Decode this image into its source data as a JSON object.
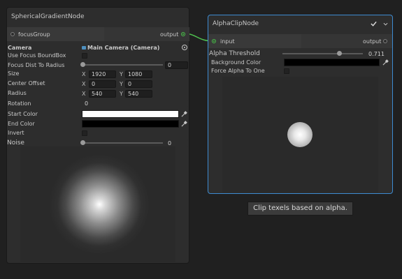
{
  "spherical_node": {
    "title": "SphericalGradientNode",
    "port": {
      "input_label": "focusGroup",
      "output_label": "output"
    },
    "camera": {
      "label": "Camera",
      "value": "Main Camera (Camera)"
    },
    "use_focus_boundbox": {
      "label": "Use Focus BoundBox",
      "checked": false
    },
    "focus_dist": {
      "label": "Focus Dist To Radius",
      "value": "0",
      "fraction": 0.0
    },
    "size": {
      "label": "Size",
      "x_axis": "X",
      "x": "1920",
      "y_axis": "Y",
      "y": "1080"
    },
    "center_offset": {
      "label": "Center Offset",
      "x_axis": "X",
      "x": "0",
      "y_axis": "Y",
      "y": "0"
    },
    "radius": {
      "label": "Radius",
      "x_axis": "X",
      "x": "540",
      "y_axis": "Y",
      "y": "540"
    },
    "rotation": {
      "label": "Rotation",
      "value": "0"
    },
    "start_color": {
      "label": "Start Color",
      "color": "#ffffff"
    },
    "end_color": {
      "label": "End Color",
      "color": "#000000"
    },
    "invert": {
      "label": "Invert",
      "checked": false
    },
    "noise": {
      "label": "Noise",
      "value": "0",
      "fraction": 0.0
    }
  },
  "alpha_node": {
    "title": "AlphaClipNode",
    "port": {
      "input_label": "input",
      "output_label": "output"
    },
    "alpha_threshold": {
      "label": "Alpha Threshold",
      "value": "0.711",
      "fraction": 0.711
    },
    "background_color": {
      "label": "Background Color",
      "color": "#000000"
    },
    "force_alpha": {
      "label": "Force Alpha To One",
      "checked": false
    }
  },
  "tooltip": "Clip texels based on alpha.",
  "colors": {
    "accent": "#3d8bd1",
    "connection": "#4fc24f"
  }
}
